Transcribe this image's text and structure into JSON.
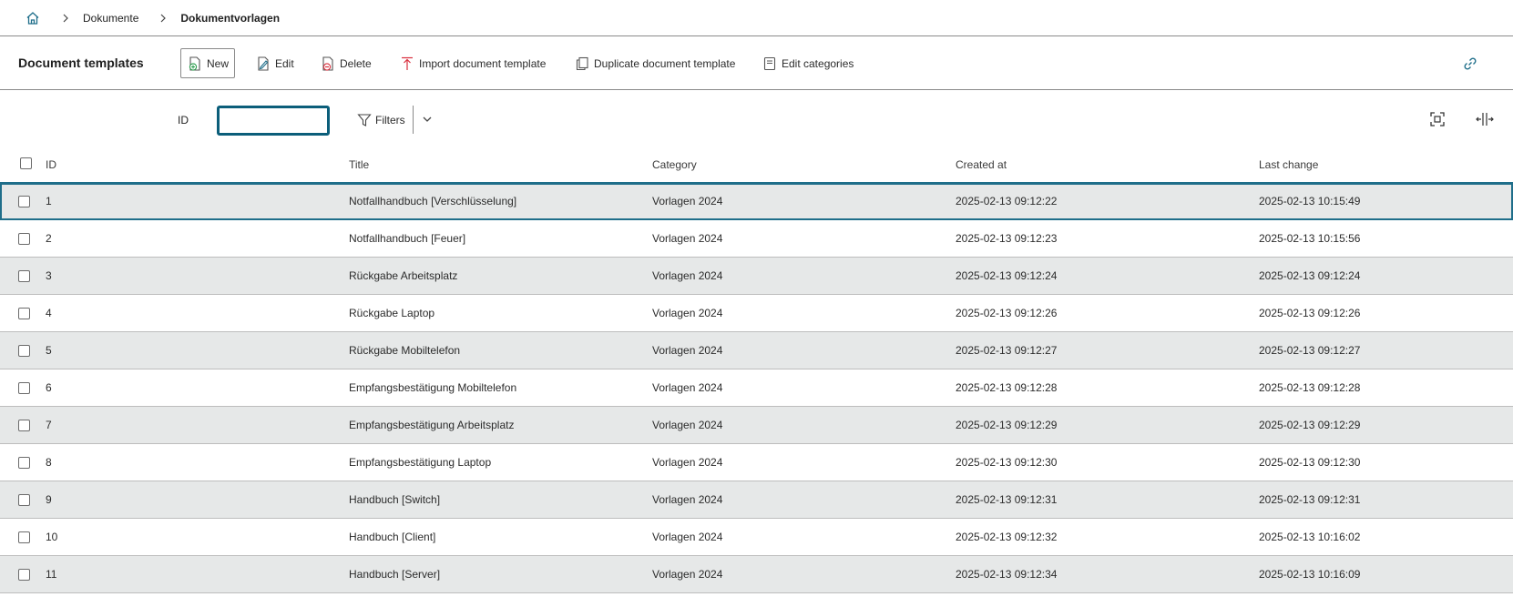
{
  "breadcrumb": {
    "items": [
      "Dokumente"
    ],
    "current": "Dokumentvorlagen"
  },
  "toolbar": {
    "title": "Document templates",
    "new_label": "New",
    "edit_label": "Edit",
    "delete_label": "Delete",
    "import_label": "Import document template",
    "duplicate_label": "Duplicate document template",
    "edit_categories_label": "Edit categories"
  },
  "filter": {
    "id_label": "ID",
    "id_value": "",
    "filters_label": "Filters"
  },
  "table": {
    "columns": [
      "ID",
      "Title",
      "Category",
      "Created at",
      "Last change"
    ],
    "rows": [
      {
        "id": "1",
        "title": "Notfallhandbuch [Verschlüsselung]",
        "category": "Vorlagen 2024",
        "created": "2025-02-13 09:12:22",
        "changed": "2025-02-13 10:15:49"
      },
      {
        "id": "2",
        "title": "Notfallhandbuch [Feuer]",
        "category": "Vorlagen 2024",
        "created": "2025-02-13 09:12:23",
        "changed": "2025-02-13 10:15:56"
      },
      {
        "id": "3",
        "title": "Rückgabe Arbeitsplatz",
        "category": "Vorlagen 2024",
        "created": "2025-02-13 09:12:24",
        "changed": "2025-02-13 09:12:24"
      },
      {
        "id": "4",
        "title": "Rückgabe Laptop",
        "category": "Vorlagen 2024",
        "created": "2025-02-13 09:12:26",
        "changed": "2025-02-13 09:12:26"
      },
      {
        "id": "5",
        "title": "Rückgabe Mobiltelefon",
        "category": "Vorlagen 2024",
        "created": "2025-02-13 09:12:27",
        "changed": "2025-02-13 09:12:27"
      },
      {
        "id": "6",
        "title": "Empfangsbestätigung Mobiltelefon",
        "category": "Vorlagen 2024",
        "created": "2025-02-13 09:12:28",
        "changed": "2025-02-13 09:12:28"
      },
      {
        "id": "7",
        "title": "Empfangsbestätigung Arbeitsplatz",
        "category": "Vorlagen 2024",
        "created": "2025-02-13 09:12:29",
        "changed": "2025-02-13 09:12:29"
      },
      {
        "id": "8",
        "title": "Empfangsbestätigung Laptop",
        "category": "Vorlagen 2024",
        "created": "2025-02-13 09:12:30",
        "changed": "2025-02-13 09:12:30"
      },
      {
        "id": "9",
        "title": "Handbuch [Switch]",
        "category": "Vorlagen 2024",
        "created": "2025-02-13 09:12:31",
        "changed": "2025-02-13 09:12:31"
      },
      {
        "id": "10",
        "title": "Handbuch [Client]",
        "category": "Vorlagen 2024",
        "created": "2025-02-13 09:12:32",
        "changed": "2025-02-13 10:16:02"
      },
      {
        "id": "11",
        "title": "Handbuch [Server]",
        "category": "Vorlagen 2024",
        "created": "2025-02-13 09:12:34",
        "changed": "2025-02-13 10:16:09"
      }
    ]
  },
  "colors": {
    "accent": "#1f6e8a",
    "input_focus": "#0b5e7a",
    "row_alt": "#e6e8e8",
    "delete_red": "#d9303e",
    "new_green": "#2e9e4f",
    "import_red": "#d9303e"
  },
  "icons": {
    "home": "home-icon",
    "chevron": "chevron-right-icon",
    "new": "document-add-icon",
    "edit": "document-edit-icon",
    "delete": "document-delete-icon",
    "import": "upload-arrow-icon",
    "duplicate": "copy-icon",
    "categories": "categories-icon",
    "link": "link-icon",
    "filter": "funnel-icon",
    "fit": "fit-screen-icon",
    "columns": "column-resize-icon"
  }
}
